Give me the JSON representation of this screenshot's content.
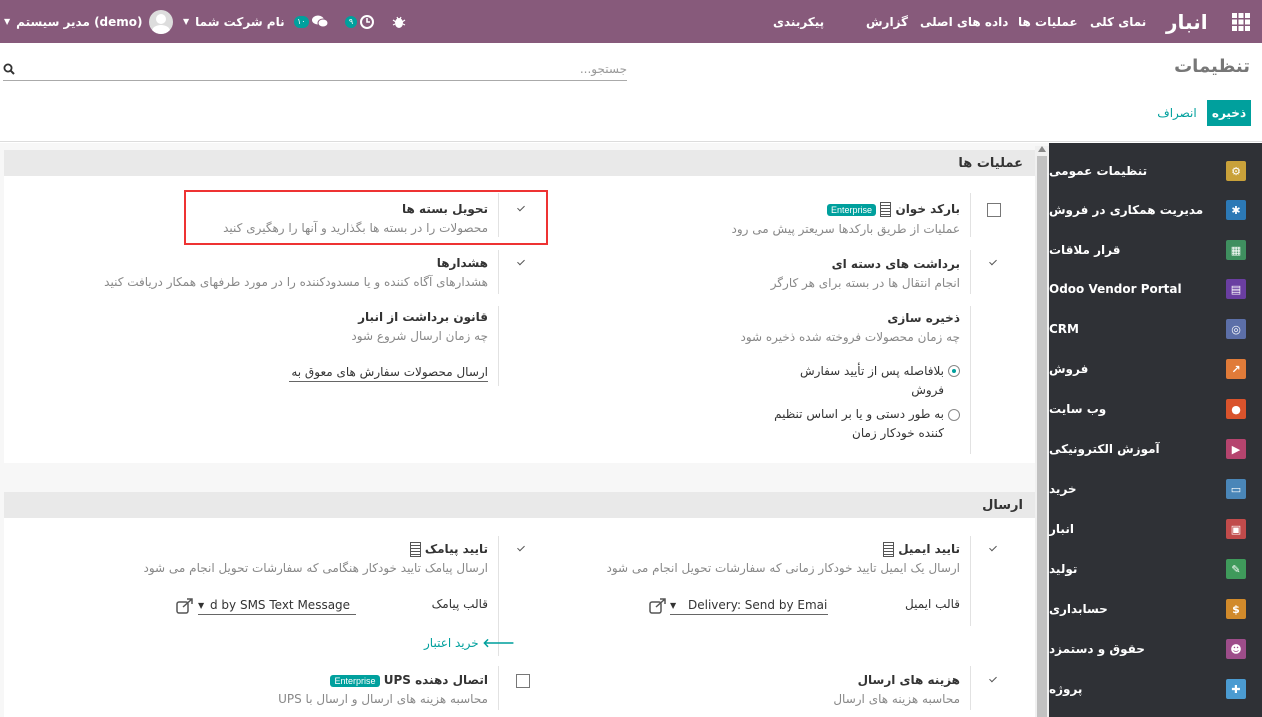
{
  "topbar": {
    "brand": "انبار",
    "menu": [
      "نمای کلی",
      "عملیات ها",
      "داده های اصلی",
      "گزارش",
      "پیکربندی"
    ],
    "user": "مدیر سیستم (demo)",
    "company": "نام شرکت شما",
    "msg_count": "۱۰",
    "activity_count": "۹"
  },
  "control": {
    "title": "تنظیمات",
    "search_placeholder": "جستجو...",
    "save": "ذخیره",
    "discard": "انصراف"
  },
  "sections": {
    "ops": {
      "title": "عملیات ها",
      "barcode": {
        "title": "بارکد خوان",
        "badge": "Enterprise",
        "desc": "عملیات از طریق بارکدها سریعتر پیش می رود"
      },
      "packages": {
        "title": "تحویل بسته ها",
        "desc": "محصولات را در بسته ها بگذارید و آنها را رهگیری کنید"
      },
      "batch": {
        "title": "برداشت های دسته ای",
        "desc": "انجام انتقال ها در بسته برای هر کارگر"
      },
      "warnings": {
        "title": "هشدارها",
        "desc": "هشدارهای آگاه کننده و یا مسدودکننده را در مورد طرفهای همکار دریافت کنید"
      },
      "reservation": {
        "title": "ذخیره سازی",
        "desc": "چه زمان محصولات فروخته شده ذخیره شود",
        "opt1_a": "بلافاصله پس از تأیید سفارش",
        "opt1_b": "فروش",
        "opt2_a": "به طور دستی و یا بر اساس تنظیم",
        "opt2_b": "کننده خودکار زمان"
      },
      "removal": {
        "title": "قانون برداشت از انبار",
        "desc": "چه زمان ارسال شروع شود",
        "value": "ارسال محصولات سفارش های معوق به"
      }
    },
    "ship": {
      "title": "ارسال",
      "email": {
        "title": "تایید ایمیل",
        "desc": "ارسال یک ایمیل تایید خودکار زمانی که سفارشات تحویل انجام می شود",
        "field_label": "قالب ایمیل",
        "value": "Delivery: Send by Email"
      },
      "sms": {
        "title": "تایید پیامک",
        "desc": "ارسال پیامک تایید خودکار هنگامی که سفارشات تحویل انجام می شود",
        "field_label": "قالب پیامک",
        "value": "d by SMS Text Message",
        "buy_credit": "خرید اعتبار"
      },
      "cost": {
        "title": "هزینه های ارسال",
        "desc": "محاسبه هزینه های ارسال"
      },
      "ups": {
        "title": "اتصال دهنده UPS",
        "badge": "Enterprise",
        "desc": "محاسبه هزینه های ارسال و ارسال با UPS"
      }
    }
  },
  "sidebar": [
    {
      "label": "تنظیمات عمومی",
      "color": "#c9a13a"
    },
    {
      "label": "مدیریت همکاری در فروش",
      "color": "#2c79b6"
    },
    {
      "label": "قرار ملاقات",
      "color": "#3f8f5f"
    },
    {
      "label": "Odoo Vendor Portal",
      "color": "#6a3ea1"
    },
    {
      "label": "CRM",
      "color": "#5c6fa8"
    },
    {
      "label": "فروش",
      "color": "#e07b39"
    },
    {
      "label": "وب سایت",
      "color": "#d9532c"
    },
    {
      "label": "آموزش الکترونیکی",
      "color": "#b5446e"
    },
    {
      "label": "خرید",
      "color": "#4a86b8"
    },
    {
      "label": "انبار",
      "color": "#c14b4b"
    },
    {
      "label": "تولید",
      "color": "#3f9a5b"
    },
    {
      "label": "حسابداری",
      "color": "#d18a2b"
    },
    {
      "label": "حقوق و دستمزد",
      "color": "#9d4d8a"
    },
    {
      "label": "پروژه",
      "color": "#4b9bd1"
    }
  ]
}
